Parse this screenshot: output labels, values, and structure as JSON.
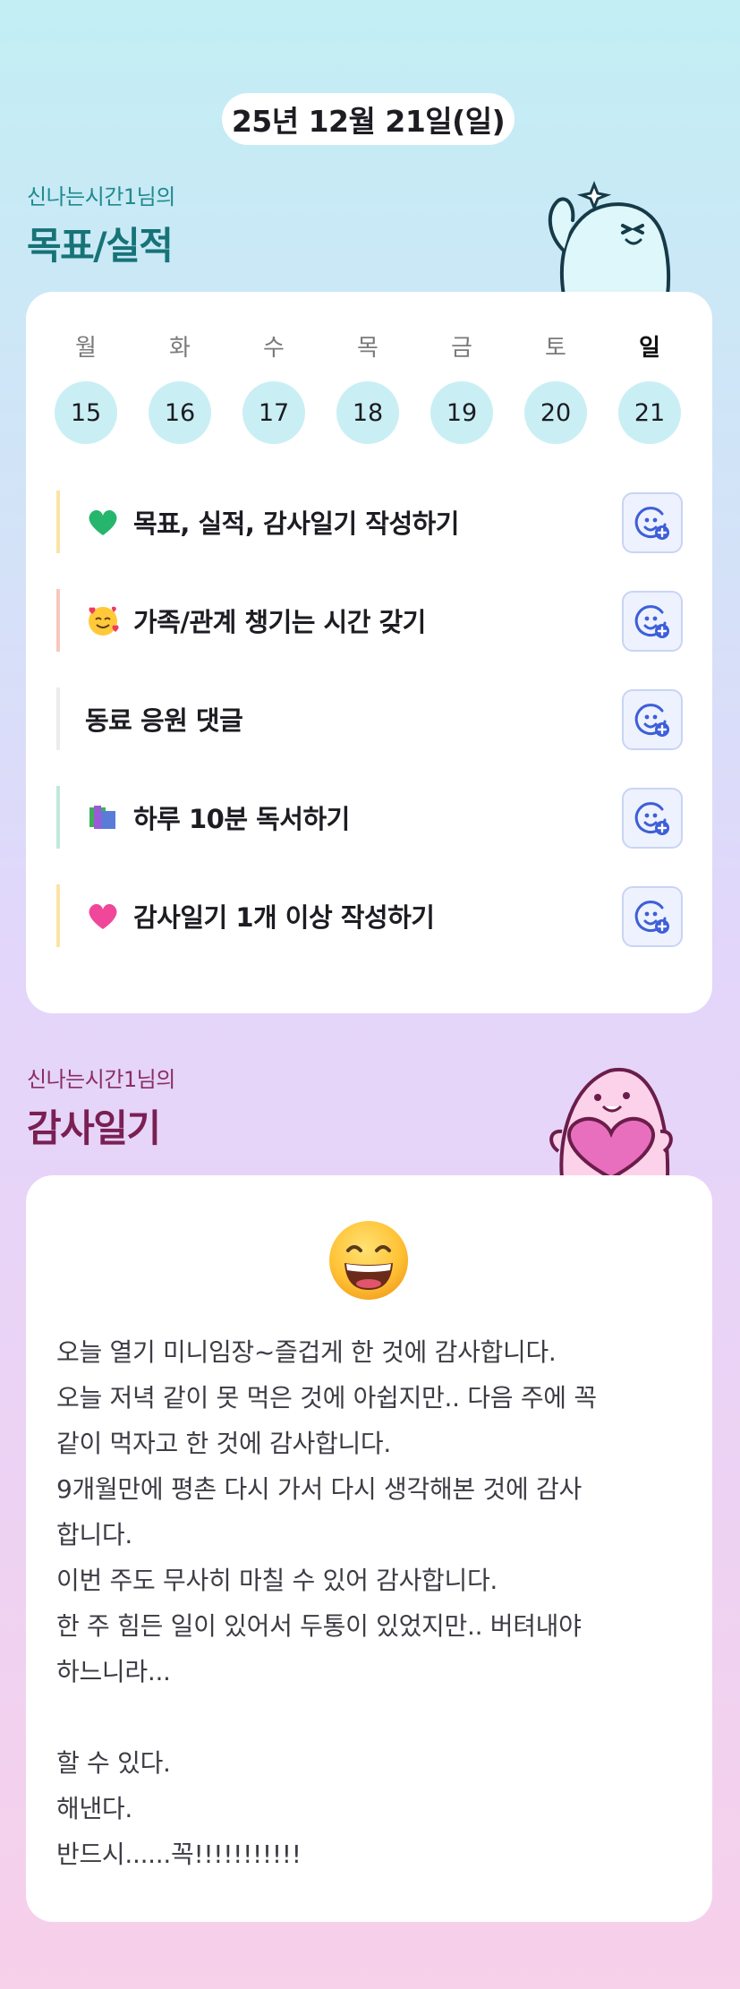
{
  "date_label": "25년 12월 21일(일)",
  "goals_section": {
    "subtitle": "신나는시간1님의",
    "title": "목표/실적"
  },
  "week": [
    {
      "name": "월",
      "num": "15"
    },
    {
      "name": "화",
      "num": "16"
    },
    {
      "name": "수",
      "num": "17"
    },
    {
      "name": "목",
      "num": "18"
    },
    {
      "name": "금",
      "num": "19"
    },
    {
      "name": "토",
      "num": "20"
    },
    {
      "name": "일",
      "num": "21"
    }
  ],
  "goals": [
    {
      "label": "목표, 실적, 감사일기 작성하기",
      "icon": "green-heart-icon",
      "accent": "#fbe3a6"
    },
    {
      "label": "가족/관계 챙기는 시간 갖기",
      "icon": "smiling-face-with-hearts-icon",
      "accent": "#f9c7bb"
    },
    {
      "label": "동료 응원 댓글",
      "icon": "",
      "accent": "#ececec"
    },
    {
      "label": "하루 10분 독서하기",
      "icon": "books-icon",
      "accent": "#bfead9"
    },
    {
      "label": "감사일기 1개 이상 작성하기",
      "icon": "pink-heart-icon",
      "accent": "#fbe3a6"
    }
  ],
  "diary_section": {
    "subtitle": "신나는시간1님의",
    "title": "감사일기"
  },
  "diary": {
    "mood_icon": "grinning-face-icon",
    "lines": [
      "오늘 열기 미니임장~즐겁게 한 것에 감사합니다.",
      "오늘 저녁 같이 못 먹은 것에 아쉽지만.. 다음 주에 꼭",
      "같이 먹자고 한 것에 감사합니다.",
      "9개월만에 평촌 다시 가서 다시 생각해본 것에 감사",
      "합니다.",
      "이번 주도 무사히 마칠 수 있어 감사합니다.",
      "한 주 힘든 일이 있어서 두통이 있었지만.. 버텨내야",
      "하느니라...",
      "",
      "할 수 있다.",
      "해낸다.",
      "반드시......꼭!!!!!!!!!!!"
    ]
  },
  "colors": {
    "bg_top": "#c2eef4",
    "bg_bottom": "#f7d0ea",
    "goal_title": "#167377",
    "diary_title": "#7a1f54",
    "day_circle": "#c9eff4"
  }
}
